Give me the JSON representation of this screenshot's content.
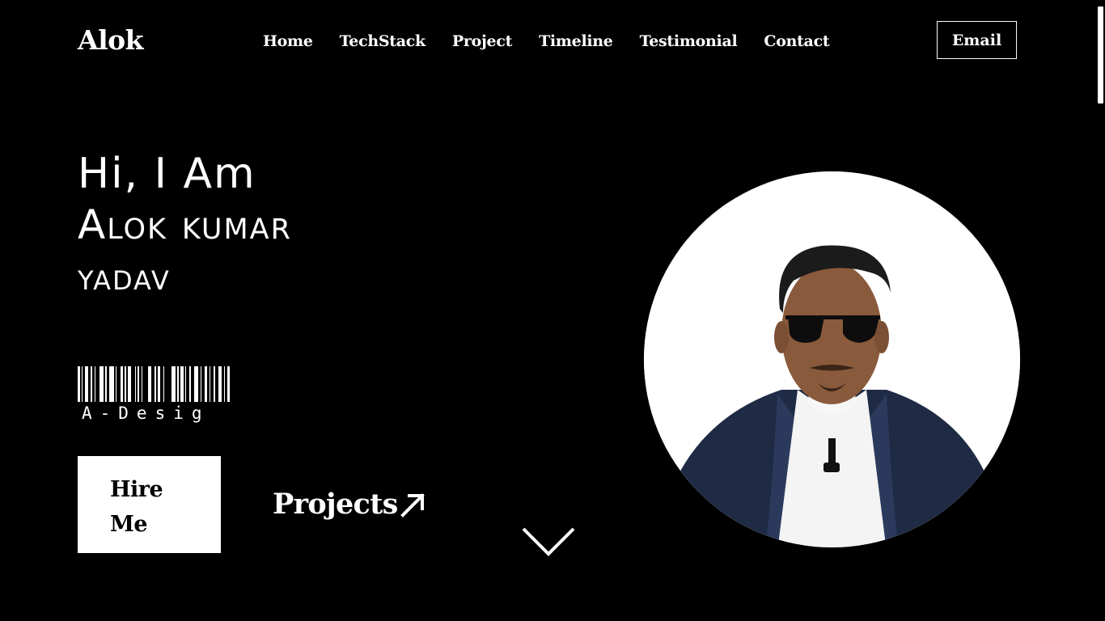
{
  "header": {
    "logo": "Alok",
    "nav": [
      {
        "label": "Home"
      },
      {
        "label": "TechStack"
      },
      {
        "label": "Project"
      },
      {
        "label": "Timeline"
      },
      {
        "label": "Testimonial"
      },
      {
        "label": "Contact"
      }
    ],
    "email_label": "Email"
  },
  "hero": {
    "greeting": "Hi, I Am",
    "name_line1": "Alok kumar",
    "name_line2": "yadav",
    "barcode_text": "A-Desig",
    "hire_label": "Hire Me",
    "projects_label": "Projects",
    "projects_icon": "arrow-up-right-icon",
    "scroll_icon": "chevron-down-icon"
  },
  "profile": {
    "photo": "profile-photo",
    "colors": {
      "background": "#000000",
      "text": "#ffffff",
      "avatar_bg": "#ffffff",
      "jacket": "#1f2a44",
      "skin": "#8a5a3c"
    }
  }
}
